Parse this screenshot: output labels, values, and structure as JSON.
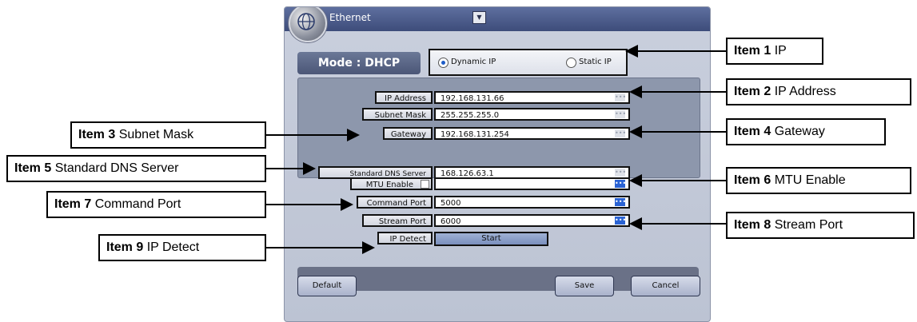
{
  "dialog": {
    "title": "Ethernet",
    "mode_label": "Mode : DHCP",
    "radio_dynamic": "Dynamic IP",
    "radio_static": "Static IP",
    "fields": {
      "ip_label": "IP Address",
      "ip_value": "192.168.131.66",
      "subnet_label": "Subnet Mask",
      "subnet_value": "255.255.255.0",
      "gateway_label": "Gateway",
      "gateway_value": "192.168.131.254",
      "dns_label": "Standard DNS Server",
      "dns_value": "168.126.63.1",
      "mtu_label": "MTU Enable",
      "mtu_value": "",
      "command_label": "Command Port",
      "command_value": "5000",
      "stream_label": "Stream Port",
      "stream_value": "6000",
      "detect_label": "IP Detect",
      "detect_button": "Start"
    },
    "more_glyph": "•••",
    "buttons": {
      "default": "Default",
      "save": "Save",
      "cancel": "Cancel"
    }
  },
  "callouts": {
    "item1": {
      "num": "Item 1",
      "text": " IP"
    },
    "item2": {
      "num": "Item 2",
      "text": " IP Address"
    },
    "item3": {
      "num": "Item 3",
      "text": " Subnet Mask"
    },
    "item4": {
      "num": "Item 4",
      "text": " Gateway"
    },
    "item5": {
      "num": "Item 5",
      "text": " Standard DNS Server"
    },
    "item6": {
      "num": "Item 6",
      "text": " MTU Enable"
    },
    "item7": {
      "num": "Item 7",
      "text": " Command Port"
    },
    "item8": {
      "num": "Item 8",
      "text": " Stream Port"
    },
    "item9": {
      "num": "Item 9",
      "text": " IP Detect"
    }
  }
}
